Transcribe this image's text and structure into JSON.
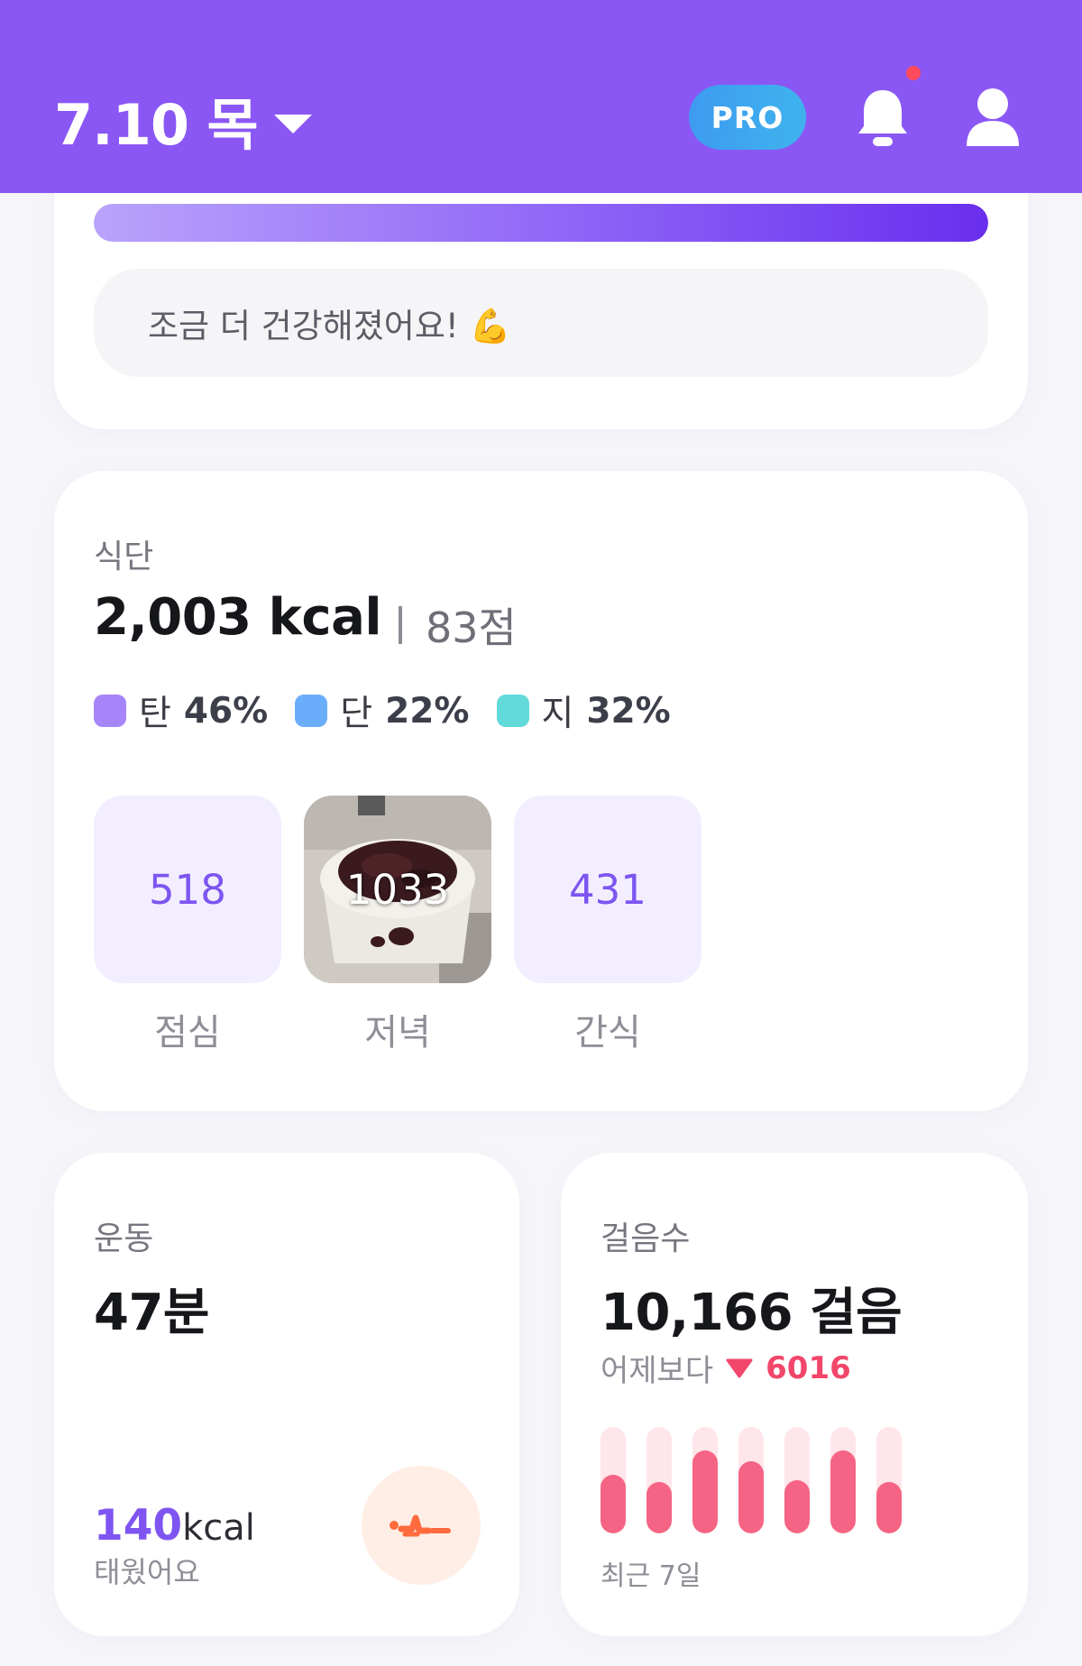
{
  "header": {
    "date": "7.10 목",
    "pro_label": "PRO",
    "has_notification": true
  },
  "summary": {
    "progress": 1.0,
    "message": "조금 더 건강해졌어요! 💪"
  },
  "diet": {
    "label": "식단",
    "kcal": "2,003 kcal",
    "score": "83점",
    "macros": [
      {
        "name": "탄",
        "pct": "46%",
        "color": "#A685F8"
      },
      {
        "name": "단",
        "pct": "22%",
        "color": "#6AAEFB"
      },
      {
        "name": "지",
        "pct": "32%",
        "color": "#62DAD9"
      }
    ],
    "meals": [
      {
        "kcal": "518",
        "label": "점심",
        "has_photo": false
      },
      {
        "kcal": "1033",
        "label": "저녁",
        "has_photo": true
      },
      {
        "kcal": "431",
        "label": "간식",
        "has_photo": false
      }
    ]
  },
  "exercise": {
    "label": "운동",
    "minutes": "47분",
    "kcal_value": "140",
    "kcal_unit": "kcal",
    "burn_label": "태웠어요",
    "icon": "person-exercise-icon"
  },
  "steps": {
    "label": "걸음수",
    "value": "10,166 걸음",
    "compare_label": "어제보다",
    "compare_value": "6016",
    "compare_direction": "down",
    "recent_label": "최근 7일",
    "weekly_fill": [
      0.55,
      0.48,
      0.78,
      0.68,
      0.5,
      0.78,
      0.48
    ]
  }
}
